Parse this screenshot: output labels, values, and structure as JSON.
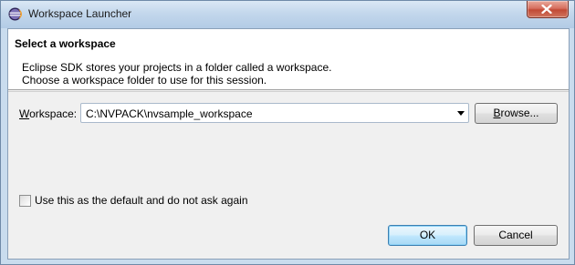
{
  "window": {
    "title": "Workspace Launcher"
  },
  "banner": {
    "heading": "Select a workspace",
    "line1": "Eclipse SDK stores your projects in a folder called a workspace.",
    "line2": "Choose a workspace folder to use for this session."
  },
  "workspace": {
    "label_mnemonic": "W",
    "label_rest": "orkspace:",
    "value": "C:\\NVPACK\\nvsample_workspace"
  },
  "buttons": {
    "browse_mnemonic": "B",
    "browse_rest": "rowse...",
    "ok": "OK",
    "cancel": "Cancel"
  },
  "checkbox": {
    "label": "Use this as the default and do not ask again",
    "checked": false
  },
  "icons": {
    "app_icon": "eclipse-icon",
    "close_icon": "close-icon",
    "dropdown_icon": "chevron-down-icon"
  }
}
